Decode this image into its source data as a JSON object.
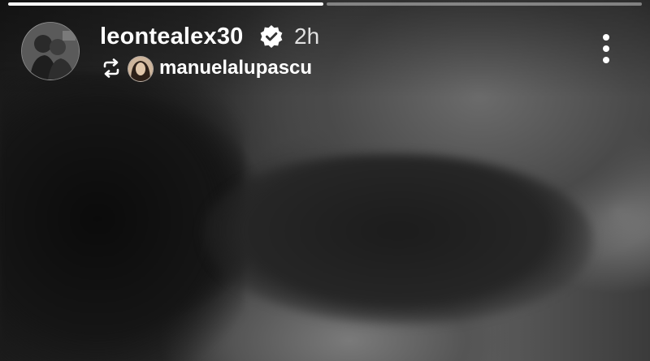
{
  "story": {
    "progress": [
      {
        "fill": 1.0
      },
      {
        "fill": 0.0
      }
    ],
    "author": {
      "username": "leontealex30",
      "verified": true,
      "time": "2h",
      "avatar_icon": "profile-photo-avatar"
    },
    "repost": {
      "icon": "repost-icon",
      "username": "manuelalupascu",
      "avatar_icon": "profile-photo-avatar"
    },
    "menu_icon": "more-vertical-icon"
  },
  "colors": {
    "text": "#ffffff",
    "progress_track": "rgba(255,255,255,0.4)",
    "progress_fill": "#ffffff"
  }
}
